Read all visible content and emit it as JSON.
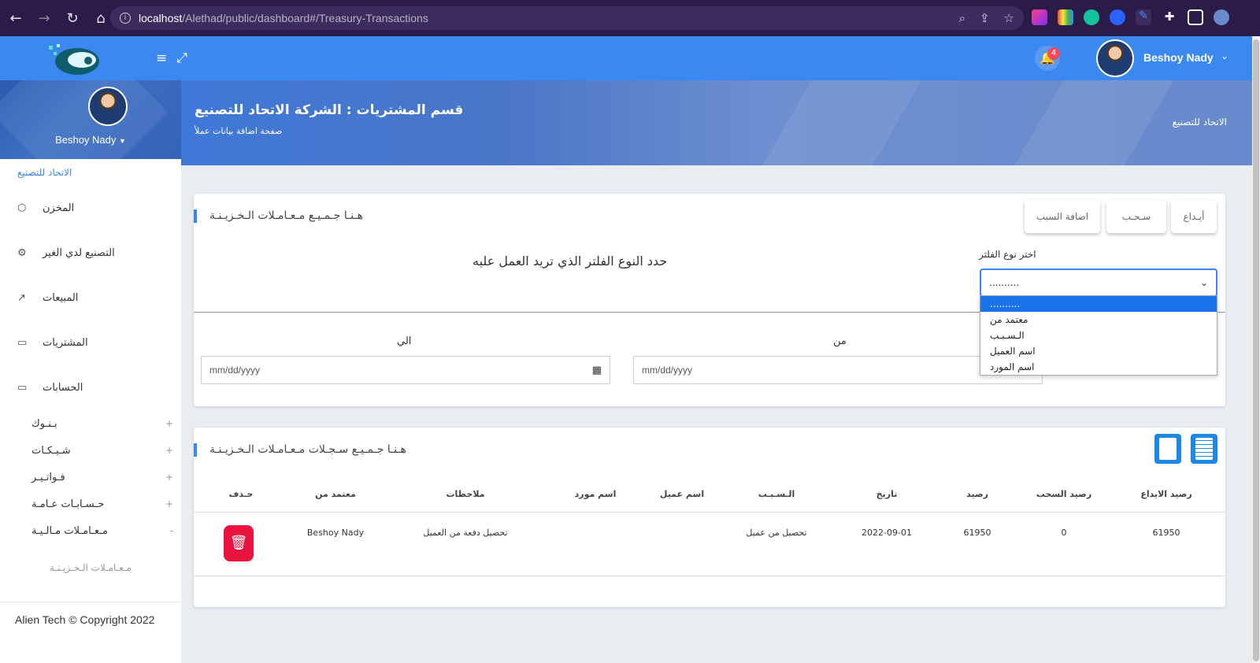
{
  "browser": {
    "url_host": "localhost",
    "url_path": "/Alethad/public/dashboard#/Treasury-Transactions"
  },
  "topbar": {
    "notification_count": "4",
    "user_name": "Beshoy Nady"
  },
  "sidebar": {
    "user_name": "Beshoy Nady",
    "company": "الاتحاد للتصنيع",
    "items": [
      {
        "label": "المخزن",
        "icon": "box-icon"
      },
      {
        "label": "التصنيع لدي الغير",
        "icon": "gear-icon"
      },
      {
        "label": "المبيعات",
        "icon": "chart-line-icon"
      },
      {
        "label": "المشتريات",
        "icon": "card-icon"
      },
      {
        "label": "الحسابات",
        "icon": "card-icon"
      }
    ],
    "subitems": [
      {
        "label": "بـنـوك",
        "toggle": "+"
      },
      {
        "label": "شـيـكـات",
        "toggle": "+"
      },
      {
        "label": "فـواتـيـر",
        "toggle": "+"
      },
      {
        "label": "حـسـابـات عـامـة",
        "toggle": "+"
      },
      {
        "label": "مـعـامـلات مـالـيـة",
        "toggle": "-"
      }
    ],
    "leaf": "مـعـامـلات الـخـزيـنـة",
    "footer": "Alien Tech © Copyright 2022"
  },
  "banner": {
    "title": "قسم المشتريات : الشركة الاتحاد للتصنيع",
    "subtitle": "صفحة اضافة بيانات عملأ",
    "right": "الاتحاد للتصنيع"
  },
  "card1": {
    "title": "هـنـا جـمـيـع مـعـامـلات الـخـزيـنـة",
    "buttons": {
      "deposit": "أيـداع",
      "withdraw": "سـحـب",
      "add_reason": "اضافة السبب"
    },
    "filter_label": "اختر نوع الفلتر",
    "filter_value": "..........",
    "filter_hint": "حدد النوع الفلتر الذي تريد العمل عليه",
    "date_to_label": "الي",
    "date_from_label": "من",
    "date_placeholder": "mm/dd/yyyy",
    "dropdown_options": [
      "..........",
      "معتمد من",
      "الـسـبـب",
      "اسم العميل",
      "اسم المورد"
    ]
  },
  "card2": {
    "title": "هـنـا جـمـيـع سـجـلات مـعـامـلات الـخـزيـنـة",
    "pdf_label": "PDF",
    "columns": [
      "رصيد الايداع",
      "رصيد السحب",
      "رصيد",
      "تاريخ",
      "الـسـبـب",
      "اسم عميل",
      "اسم مورد",
      "ملاحظات",
      "معتمد من",
      "حـذف"
    ],
    "rows": [
      {
        "deposit": "61950",
        "withdraw": "0",
        "balance": "61950",
        "date": "2022-09-01",
        "reason": "تحصيل من عميل",
        "client": "",
        "supplier": "",
        "notes": "تحصيل دفعة من العميل",
        "approved_by": "Beshoy Nady"
      }
    ]
  }
}
